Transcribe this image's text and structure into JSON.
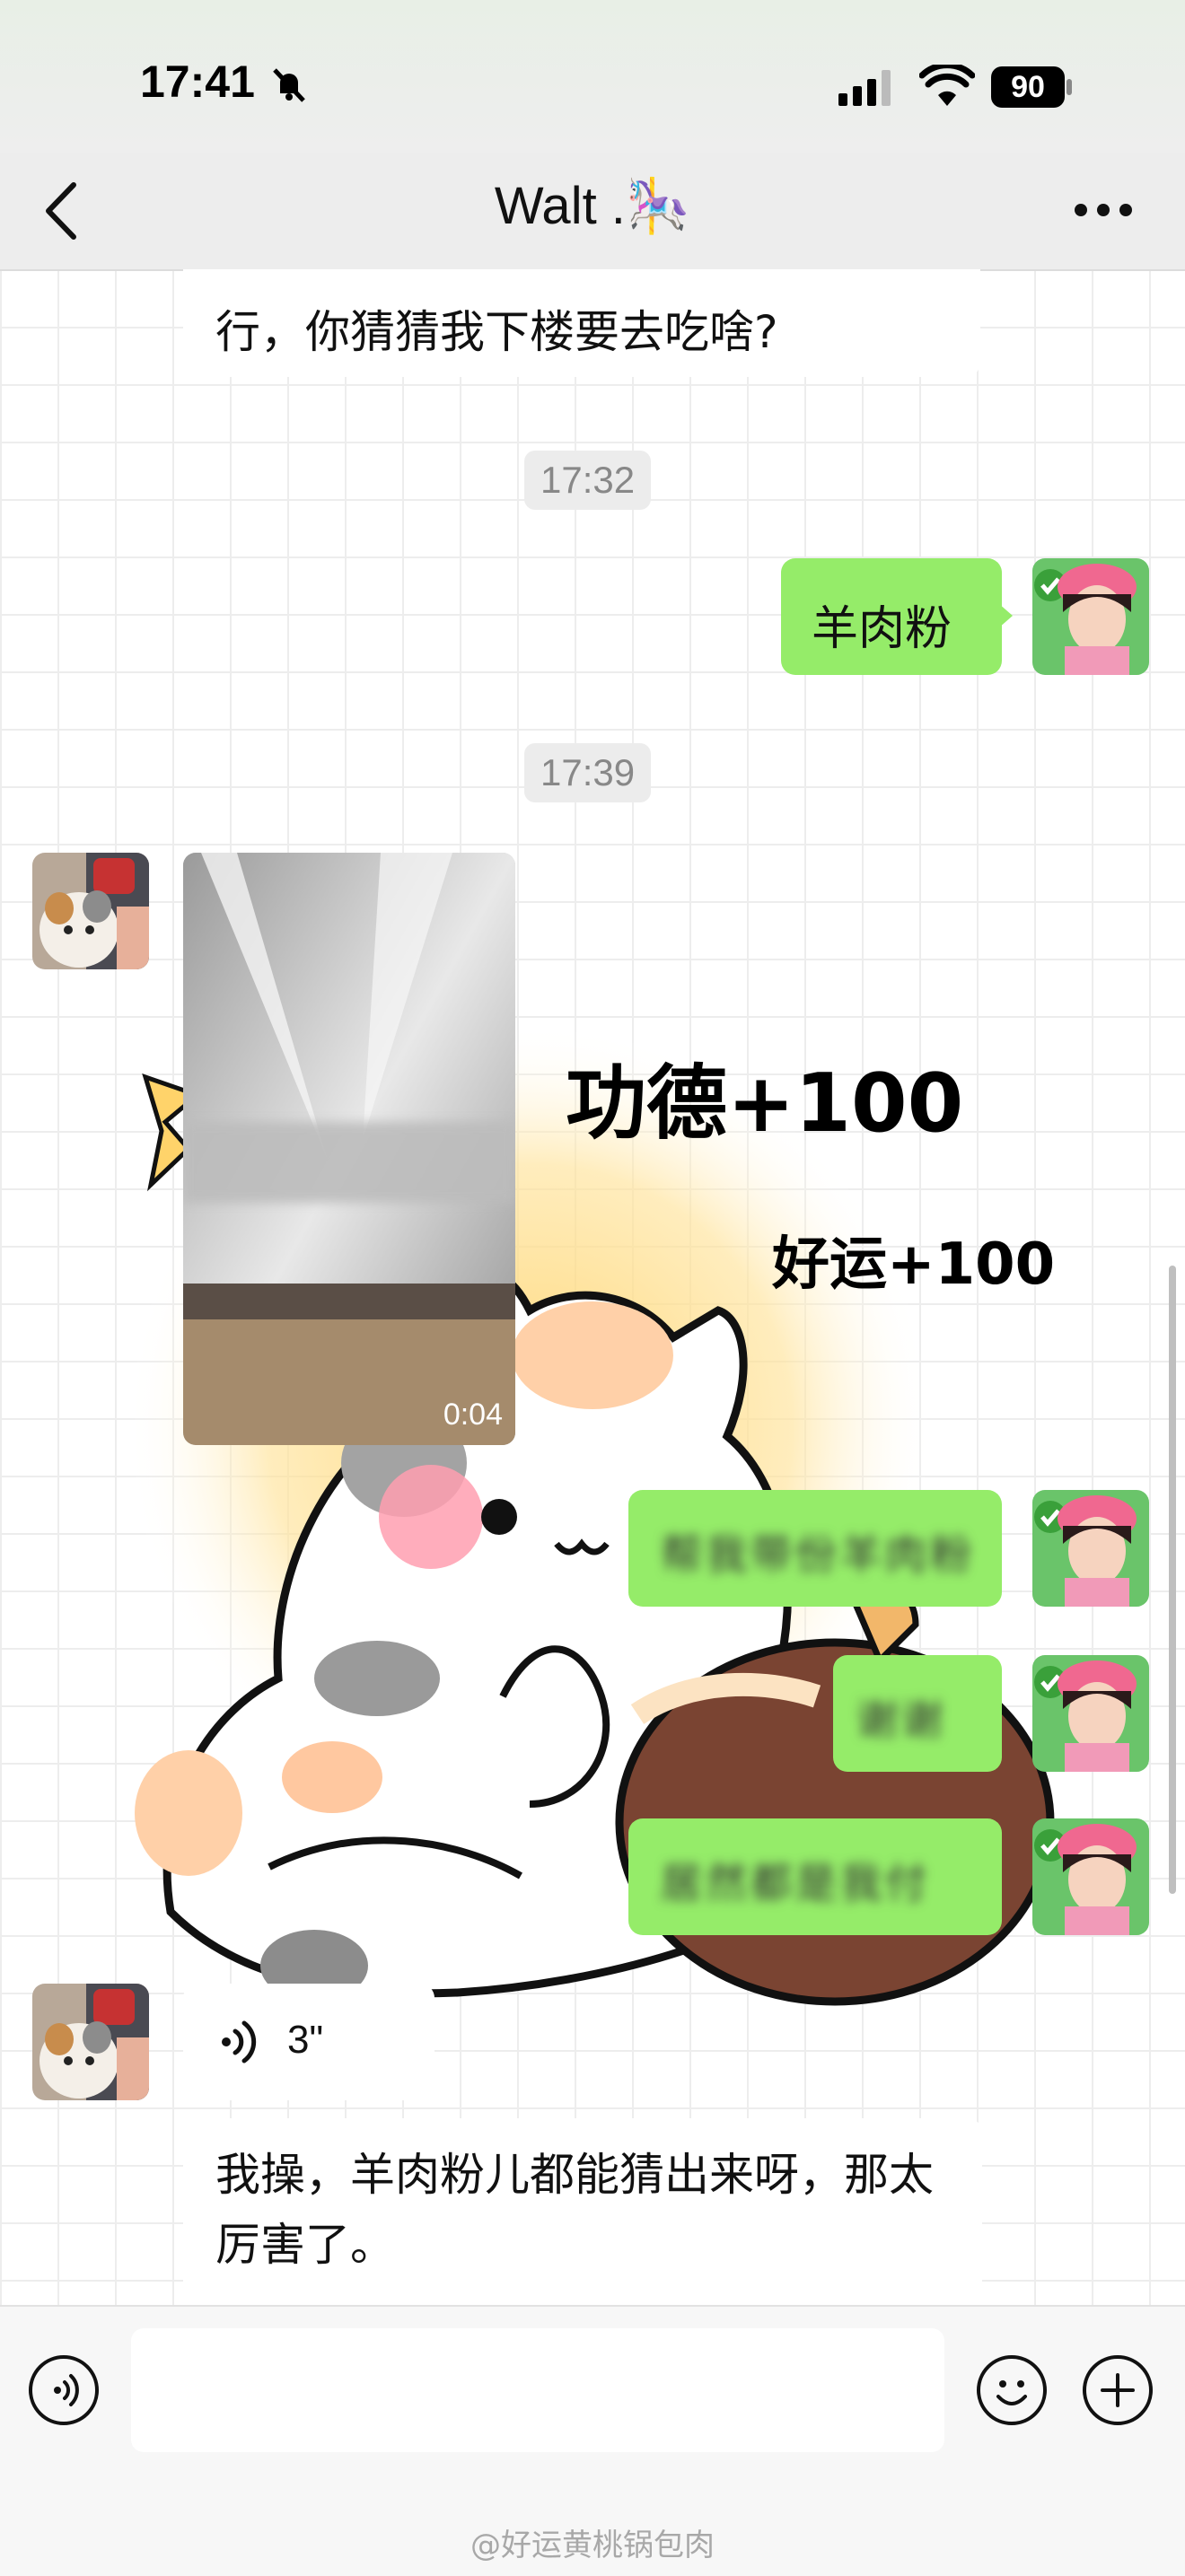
{
  "status_bar": {
    "time": "17:41",
    "battery": "90"
  },
  "header": {
    "contact_name": "Walt .🎠"
  },
  "messages": [
    {
      "text": "行，你猜猜我下楼要去吃啥?"
    },
    {
      "timestamp": "17:32"
    },
    {
      "text": "羊肉粉"
    },
    {
      "timestamp": "17:39"
    },
    {
      "video_duration": "0:04"
    },
    {
      "sticker_text_1": "功德+100",
      "sticker_text_2": "好运+100"
    },
    {
      "blurred_1": "帮我带份羊肉粉"
    },
    {
      "blurred_2": "谢谢"
    },
    {
      "blurred_3": "居然都是我付"
    },
    {
      "voice_duration": "3\""
    },
    {
      "text": "我操，羊肉粉儿都能猜出来呀，那太厉害了。"
    }
  ],
  "watermark": "@好运黄桃锅包肉"
}
